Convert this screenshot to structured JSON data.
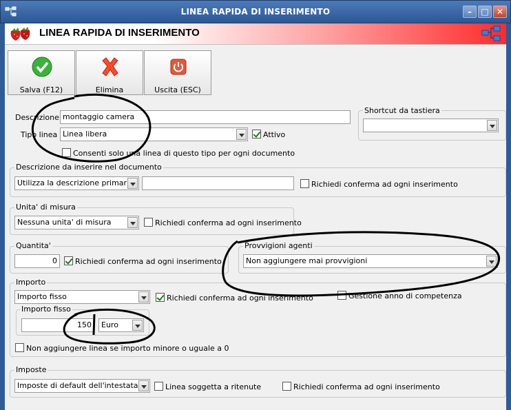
{
  "window": {
    "title": "LINEA RAPIDA DI INSERIMENTO",
    "minimize": "–",
    "maximize": "□",
    "close": "✕"
  },
  "header": {
    "title": "LINEA RAPIDA DI INSERIMENTO",
    "accent": "#ff2a2a"
  },
  "toolbar": {
    "save_label": "Salva (F12)",
    "delete_label": "Elimina",
    "exit_label": "Uscita (ESC)"
  },
  "form": {
    "descrizione_label": "Descrizione :",
    "descrizione_value": "montaggio camera",
    "tipo_linea_label": "Tipo linea :",
    "tipo_linea_value": "Linea libera",
    "attivo_label": "Attivo",
    "attivo_checked": true,
    "consenti_label": "Consenti solo una linea di questo tipo per ogni documento",
    "consenti_checked": false
  },
  "shortcut": {
    "label": "Shortcut da tastiera",
    "value": ""
  },
  "descrizione_doc": {
    "label": "Descrizione da inserire nel documento",
    "select_value": "Utilizza la descrizione primaria",
    "text_value": "",
    "confirm_label": "Richiedi conferma ad ogni inserimento",
    "confirm_checked": false
  },
  "unita": {
    "label": "Unita' di misura",
    "select_value": "Nessuna unita' di misura",
    "confirm_label": "Richiedi conferma ad ogni inserimento",
    "confirm_checked": false
  },
  "quantita": {
    "label": "Quantita'",
    "value": "0",
    "confirm_label": "Richiedi conferma ad ogni inserimento",
    "confirm_checked": true
  },
  "provvigioni": {
    "label": "Provvigioni agenti",
    "select_value": "Non aggiungere mai provvigioni"
  },
  "importo": {
    "label": "Importo",
    "select_value": "Importo fisso",
    "confirm_label": "Richiedi conferma ad ogni inserimento",
    "confirm_checked": true,
    "competenza_label": "Gestione anno di competenza",
    "competenza_checked": false,
    "fisso_label": "Importo fisso",
    "fisso_value": "150",
    "currency_value": "Euro",
    "non_aggiungere_label": "Non aggiungere linea se importo minore o uguale a 0",
    "non_aggiungere_checked": false
  },
  "imposte": {
    "label": "Imposte",
    "select_value": "Imposte di default dell'intestatario",
    "ritenute_label": "Linea soggetta a ritenute",
    "ritenute_checked": false,
    "confirm_label": "Richiedi conferma ad ogni inserimento",
    "confirm_checked": false
  }
}
